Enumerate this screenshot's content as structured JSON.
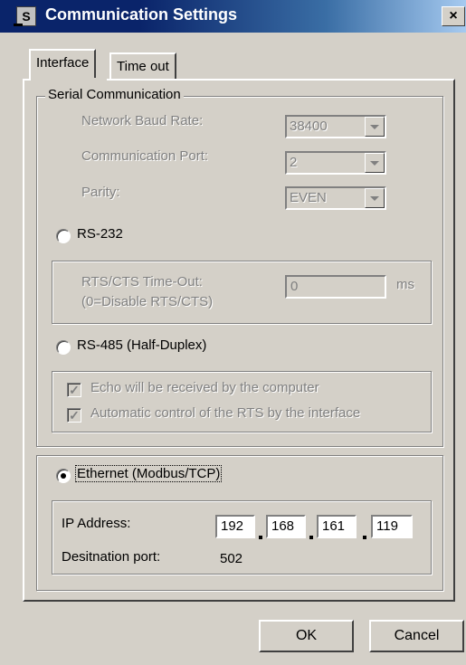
{
  "window": {
    "title": "Communication Settings",
    "icon_letter": "S",
    "close_label": "×"
  },
  "tabs": [
    {
      "label": "Interface",
      "active": true
    },
    {
      "label": "Time out",
      "active": false
    }
  ],
  "serial": {
    "group_label": "Serial Communication",
    "baud_label": "Network Baud Rate:",
    "baud_value": "38400",
    "port_label": "Communication Port:",
    "port_value": "2",
    "parity_label": "Parity:",
    "parity_value": "EVEN",
    "rs232_label": "RS-232",
    "rts_label_1": "RTS/CTS Time-Out:",
    "rts_label_2": "(0=Disable RTS/CTS)",
    "rts_value": "0",
    "rts_unit": "ms",
    "rs485_label": "RS-485 (Half-Duplex)",
    "echo_label": "Echo will be received by the computer",
    "autortc_label": "Automatic control of the RTS by the interface"
  },
  "ethernet": {
    "label": "Ethernet (Modbus/TCP)",
    "ip_label": "IP Address:",
    "ip": [
      "192",
      "168",
      "161",
      "119"
    ],
    "port_label": "Desitnation port:",
    "port_value": "502"
  },
  "buttons": {
    "ok": "OK",
    "cancel": "Cancel"
  }
}
